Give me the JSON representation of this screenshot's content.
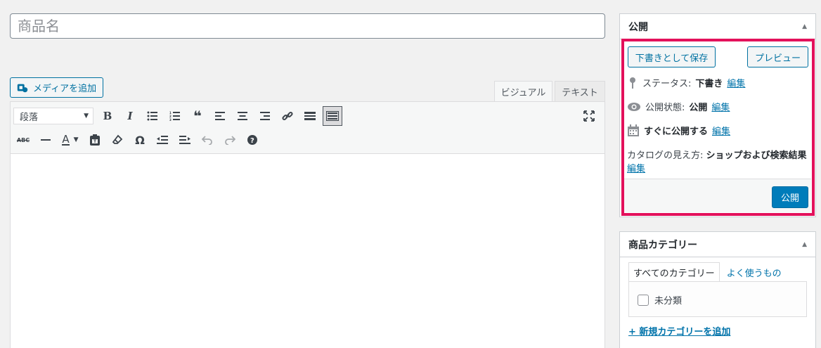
{
  "title_input": {
    "placeholder": "商品名"
  },
  "media": {
    "add_label": "メディアを追加"
  },
  "editor": {
    "tab_visual": "ビジュアル",
    "tab_text": "テキスト",
    "format_select": "段落",
    "toolbar_row1": [
      "bold-icon",
      "italic-icon",
      "bullet-list-icon",
      "numbered-list-icon",
      "blockquote-icon",
      "align-left-icon",
      "align-center-icon",
      "align-right-icon",
      "link-icon",
      "read-more-icon",
      "toolbar-toggle-icon"
    ],
    "toolbar_row2": [
      "strikethrough-icon",
      "horizontal-line-icon",
      "text-color-icon",
      "paste-text-icon",
      "clear-formatting-icon",
      "special-character-icon",
      "outdent-icon",
      "indent-icon",
      "undo-icon",
      "redo-icon",
      "help-icon"
    ]
  },
  "publish_box": {
    "title": "公開",
    "save_draft": "下書きとして保存",
    "preview": "プレビュー",
    "status_label": "ステータス:",
    "status_value": "下書き",
    "visibility_label": "公開状態:",
    "visibility_value": "公開",
    "schedule_label": "すぐに公開する",
    "catalog_label": "カタログの見え方:",
    "catalog_value": "ショップおよび検索結果",
    "edit_link": "編集",
    "publish_button": "公開",
    "highlight_color": "#e3115b"
  },
  "category_box": {
    "title": "商品カテゴリー",
    "tab_all": "すべてのカテゴリー",
    "tab_popular": "よく使うもの",
    "items": [
      {
        "label": "未分類",
        "checked": false
      }
    ],
    "add_new": "+ 新規カテゴリーを追加"
  },
  "colors": {
    "accent": "#0073aa",
    "primary_button": "#007cba",
    "background": "#f1f1f1"
  }
}
